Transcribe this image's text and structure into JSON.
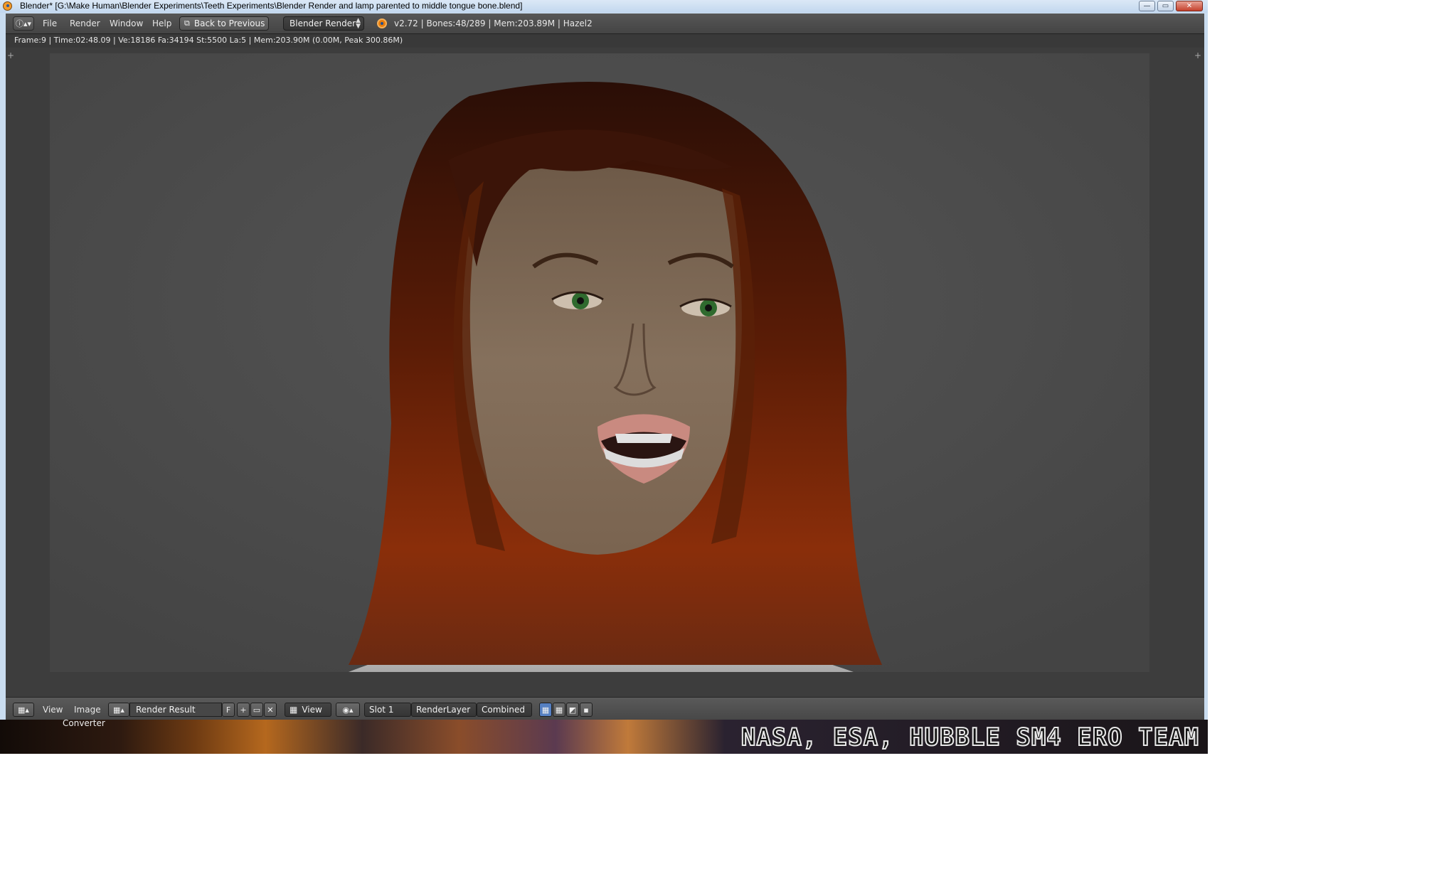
{
  "window": {
    "title": "Blender* [G:\\Make Human\\Blender Experiments\\Teeth Experiments\\Blender Render and lamp parented to middle tongue bone.blend]",
    "minimize": "—",
    "maximize": "▭",
    "close": "✕"
  },
  "info_header": {
    "menus": [
      "File",
      "Render",
      "Window",
      "Help"
    ],
    "back_button": "Back to Previous",
    "render_engine": "Blender Render",
    "status": "v2.72 | Bones:48/289  | Mem:203.89M | Hazel2"
  },
  "stats": "Frame:9 | Time:02:48.09 | Ve:18186 Fa:34194 St:5500 La:5 | Mem:203.90M (0.00M, Peak 300.86M)",
  "image_editor_header": {
    "menus": [
      "View",
      "Image"
    ],
    "image_name": "Render Result",
    "fake_user": "F",
    "view_dropdown": "View",
    "slot": "Slot 1",
    "render_layer": "RenderLayer",
    "pass": "Combined"
  },
  "desktop": {
    "icon_label": "Converter",
    "credit": "NASA, ESA, HUBBLE SM4 ERO TEAM"
  },
  "icons": {
    "app": "blender-logo-icon",
    "editor_type": "info-icon",
    "image_browse": "image-icon",
    "new": "plus-icon",
    "open": "folder-icon",
    "unlink": "x-icon",
    "scope": "scope-icon"
  }
}
